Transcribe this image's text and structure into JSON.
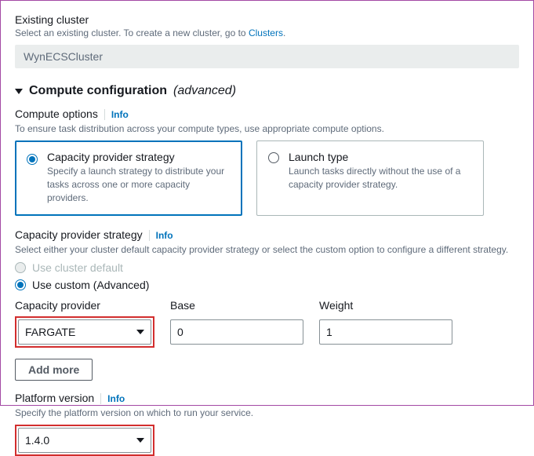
{
  "existing_cluster": {
    "title": "Existing cluster",
    "help_prefix": "Select an existing cluster. To create a new cluster, go to ",
    "help_link": "Clusters",
    "help_suffix": ".",
    "value": "WynECSCluster"
  },
  "compute_config": {
    "header": "Compute configuration",
    "header_adv": "(advanced)"
  },
  "compute_options": {
    "title": "Compute options",
    "info": "Info",
    "help": "To ensure task distribution across your compute types, use appropriate compute options.",
    "tile_cps": {
      "title": "Capacity provider strategy",
      "desc": "Specify a launch strategy to distribute your tasks across one or more capacity providers."
    },
    "tile_lt": {
      "title": "Launch type",
      "desc": "Launch tasks directly without the use of a capacity provider strategy."
    }
  },
  "cps": {
    "title": "Capacity provider strategy",
    "info": "Info",
    "help": "Select either your cluster default capacity provider strategy or select the custom option to configure a different strategy.",
    "opt_default": "Use cluster default",
    "opt_custom": "Use custom (Advanced)"
  },
  "cp_table": {
    "col_provider": "Capacity provider",
    "col_base": "Base",
    "col_weight": "Weight",
    "provider_value": "FARGATE",
    "base_value": "0",
    "weight_value": "1",
    "add_more": "Add more"
  },
  "platform_version": {
    "title": "Platform version",
    "info": "Info",
    "help": "Specify the platform version on which to run your service.",
    "value": "1.4.0"
  }
}
